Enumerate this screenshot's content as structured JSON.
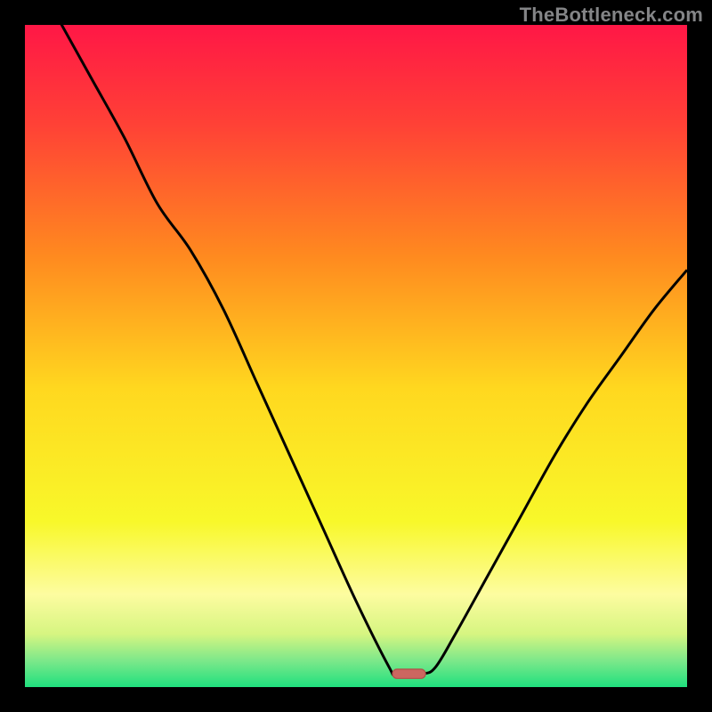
{
  "attribution": "TheBottleneck.com",
  "chart_data": {
    "type": "line",
    "title": "",
    "xlabel": "",
    "ylabel": "",
    "xlim": [
      0,
      100
    ],
    "ylim": [
      0,
      100
    ],
    "grid": false,
    "background_gradient": {
      "type": "vertical",
      "stops": [
        {
          "offset": 0.0,
          "color": "#ff1746"
        },
        {
          "offset": 0.15,
          "color": "#ff4136"
        },
        {
          "offset": 0.35,
          "color": "#ff8a1f"
        },
        {
          "offset": 0.55,
          "color": "#ffd81f"
        },
        {
          "offset": 0.75,
          "color": "#f8f82a"
        },
        {
          "offset": 0.86,
          "color": "#fdfca0"
        },
        {
          "offset": 0.92,
          "color": "#d6f581"
        },
        {
          "offset": 0.96,
          "color": "#7de88a"
        },
        {
          "offset": 1.0,
          "color": "#1fe07e"
        }
      ]
    },
    "series": [
      {
        "name": "bottleneck-curve",
        "color": "#000000",
        "stroke_width": 3,
        "x": [
          0,
          5,
          10,
          15,
          20,
          25,
          30,
          35,
          40,
          45,
          50,
          55,
          56,
          60,
          62,
          65,
          70,
          75,
          80,
          85,
          90,
          95,
          100
        ],
        "y": [
          110,
          101,
          92,
          83,
          73,
          66,
          57,
          46,
          35,
          24,
          13,
          3,
          2,
          2,
          3,
          8,
          17,
          26,
          35,
          43,
          50,
          57,
          63
        ]
      }
    ],
    "markers": [
      {
        "name": "min-marker",
        "type": "pill",
        "x": 58,
        "y": 2,
        "width_pct": 5,
        "height_pct": 1.4,
        "fill": "#cc6660",
        "stroke": "#b24f49"
      }
    ]
  }
}
